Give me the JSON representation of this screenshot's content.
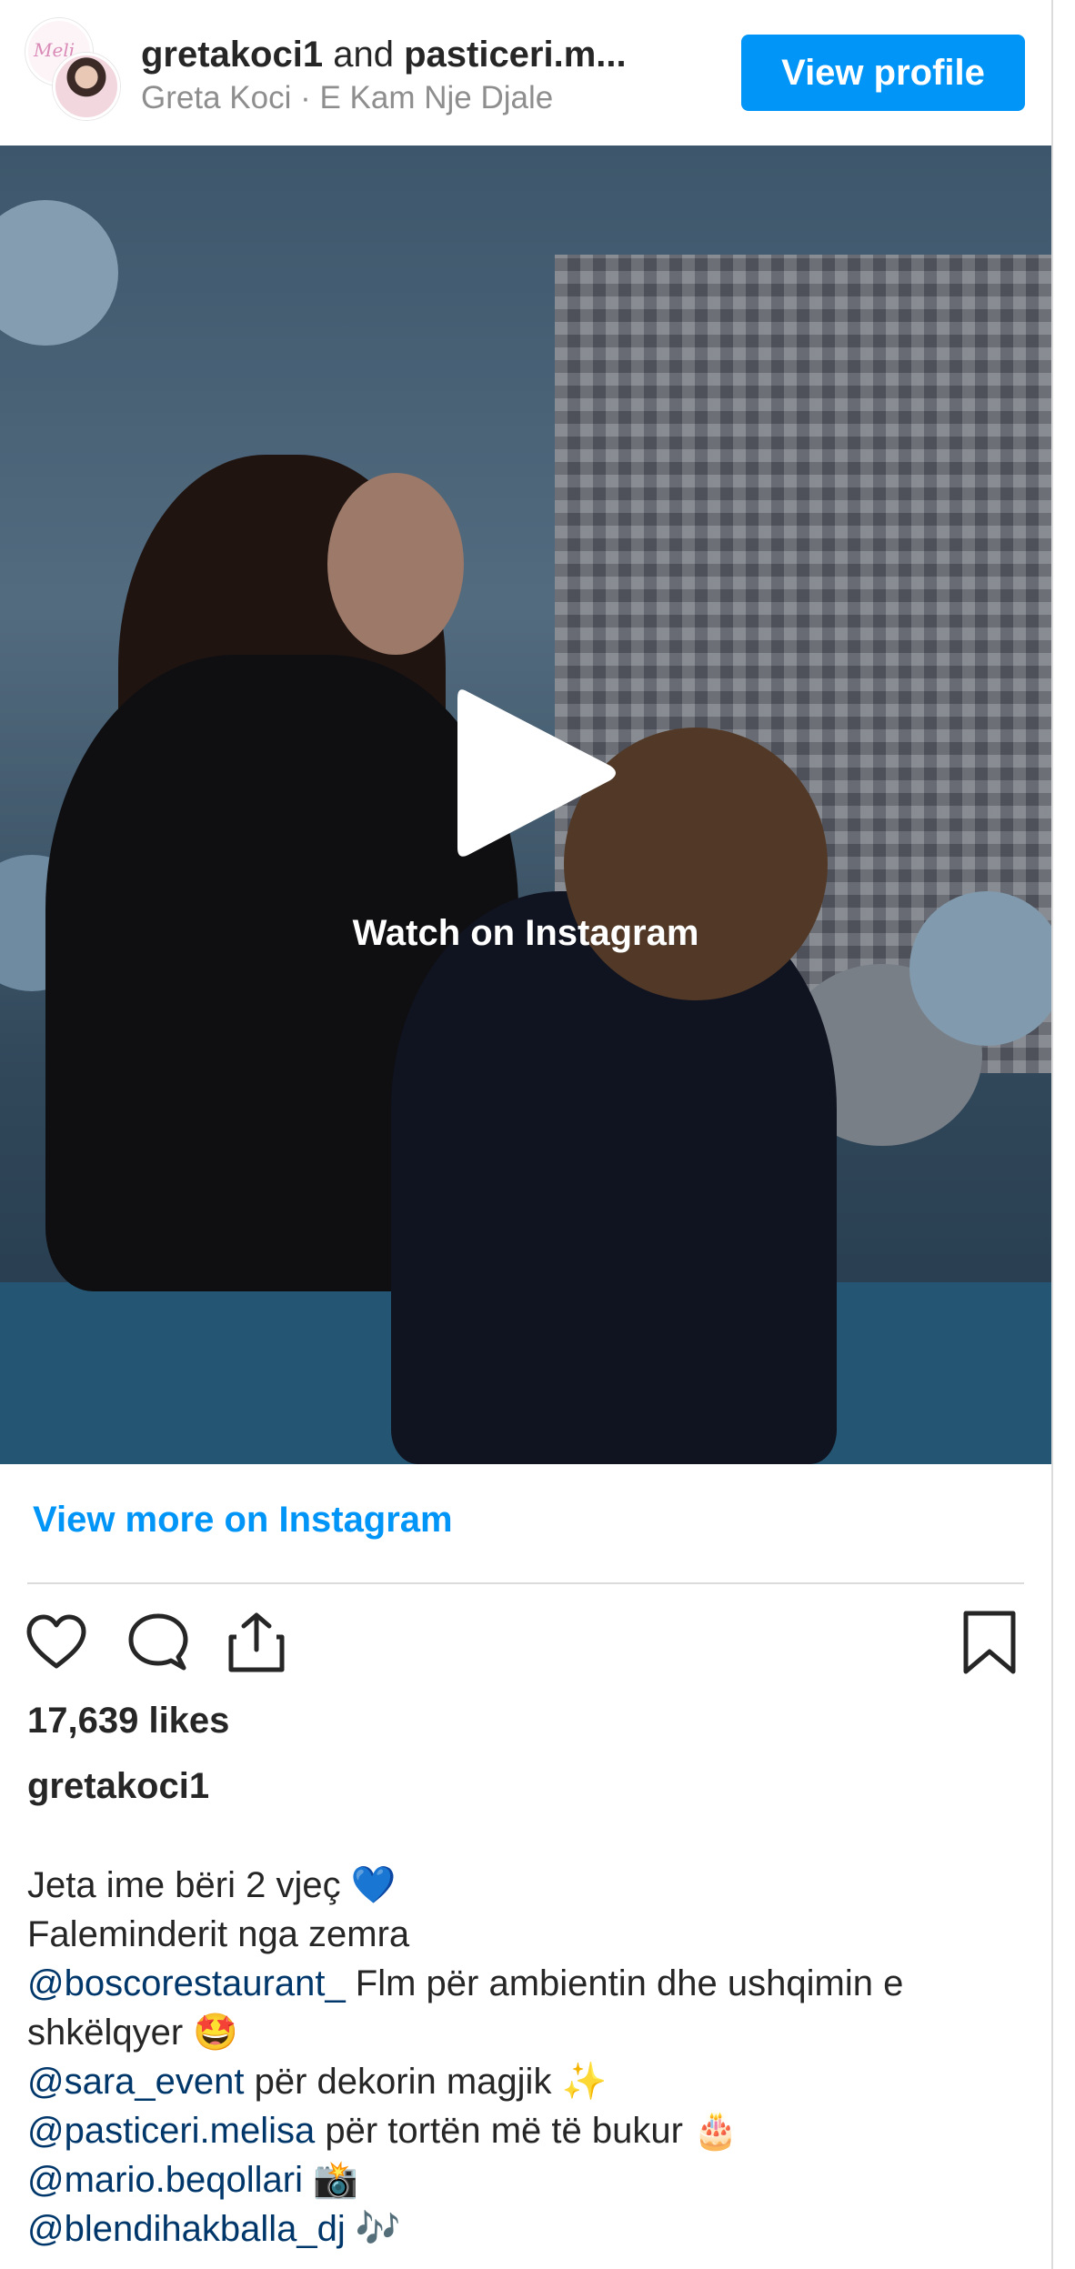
{
  "header": {
    "user1": "gretakoci1",
    "joiner": " and ",
    "user2": "pasticeri.m...",
    "subtitle": "Greta Koci · E Kam Nje Djale",
    "avatar_back_text": "Meli",
    "view_profile_label": "View profile"
  },
  "media": {
    "watch_label": "Watch on Instagram"
  },
  "post": {
    "view_more_label": "View more on Instagram",
    "likes": "17,639 likes",
    "username": "gretakoci1",
    "caption": {
      "line1": "Jeta ime bëri 2 vjeç 💙",
      "line2": "Faleminderit nga zemra",
      "line3_mention": "@boscorestaurant_",
      "line3_text": " Flm për ambientin dhe ushqimin e shkëlqyer 🤩",
      "line4_mention": "@sara_event",
      "line4_text": " për dekorin magjik ✨",
      "line5_mention": "@pasticeri.melisa",
      "line5_text": " për tortën më të bukur 🎂",
      "line6_mention": "@mario.beqollari",
      "line6_text": " 📸",
      "line7_mention": "@blendihakballa_dj",
      "line7_text": " 🎶"
    }
  },
  "icons": {
    "like": "heart-icon",
    "comment": "comment-icon",
    "share": "share-icon",
    "save": "bookmark-icon",
    "play": "play-icon"
  },
  "colors": {
    "accent": "#0095f6",
    "mention": "#00376b",
    "text": "#262626",
    "muted": "#8e8e8e"
  }
}
